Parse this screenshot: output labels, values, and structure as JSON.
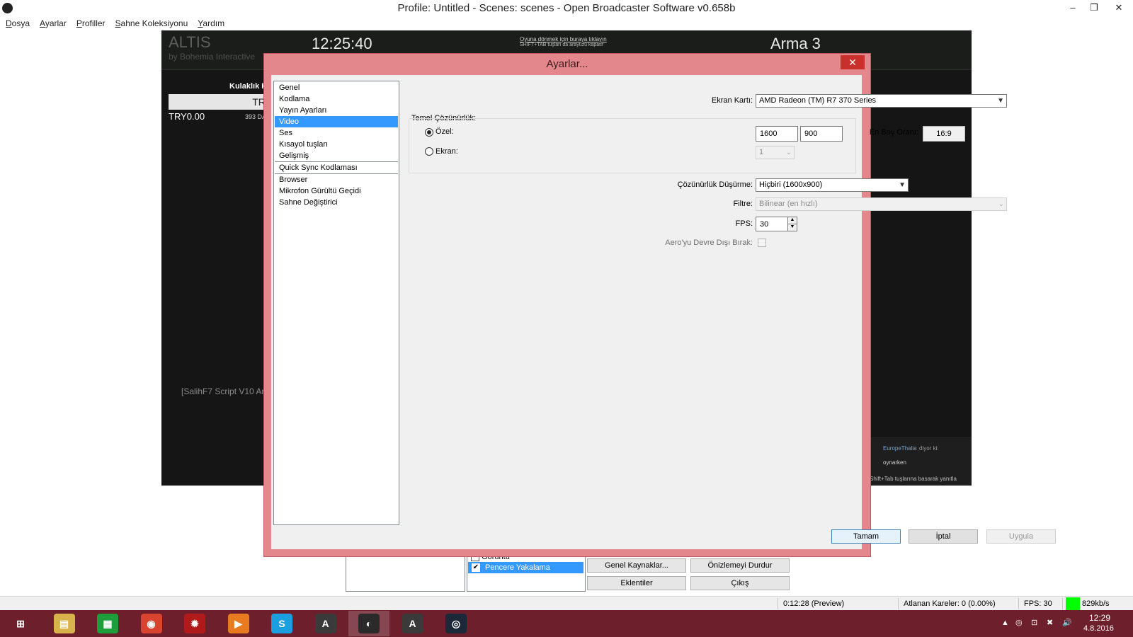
{
  "window": {
    "title": "Profile: Untitled - Scenes: scenes - Open Broadcaster Software v0.658b",
    "minimize": "–",
    "maximize": "❐",
    "close": "✕"
  },
  "menubar": [
    "Dosya",
    "Ayarlar",
    "Profiller",
    "Sahne Koleksiyonu",
    "Yardım"
  ],
  "preview": {
    "map_title": "ALTIS",
    "map_subtitle": "by Bohemia Interactive",
    "clock": "12:25:40",
    "overlay_line1": "Oyuna dönmek için buraya tıklayın",
    "overlay_line2": "SHIFT+TAB tuşları da arayüzü kapatır",
    "game_name": "Arma 3",
    "headset_label": "Kulaklık K",
    "price_box": "TRY",
    "balance": "TRY0.00",
    "balance_sub": "393 DA",
    "script_text": "[SalihF7 Script V10 Ar",
    "chat_user": "EuropeThalia",
    "chat_says": "diyor ki:",
    "chat_message": "oynarken",
    "chat_hint": "Shift+Tab tuşlarına basarak yanıtla"
  },
  "dialog": {
    "title": "Ayarlar...",
    "close": "✕",
    "nav_items": [
      "Genel",
      "Kodlama",
      "Yayın Ayarları",
      "Video",
      "Ses",
      "Kısayol tuşları",
      "Gelişmiş",
      "Quick Sync Kodlaması",
      "Browser",
      "Mikrofon Gürültü Geçidi",
      "Sahne Değiştirici"
    ],
    "selected_nav": "Video",
    "video": {
      "gpu_label": "Ekran Kartı:",
      "gpu_value": "AMD Radeon (TM) R7 370 Series",
      "base_res_label": "Temel Çözünürlük:",
      "custom_label": "Özel:",
      "custom_width": "1600",
      "custom_height": "900",
      "aspect_label": "En Boy Oranı:",
      "aspect_value": "16:9",
      "monitor_label": "Ekran:",
      "monitor_value": "1",
      "downscale_label": "Çözünürlük Düşürme:",
      "downscale_value": "Hiçbiri  (1600x900)",
      "filter_label": "Filtre:",
      "filter_value": "Bilinear (en hızlı)",
      "fps_label": "FPS:",
      "fps_value": "30",
      "aero_label": "Aero'yu Devre Dışı Bırak:"
    },
    "buttons": {
      "ok": "Tamam",
      "cancel": "İptal",
      "apply": "Uygula"
    }
  },
  "main": {
    "sources": [
      {
        "label": "Görüntü",
        "checked": false
      },
      {
        "label": "Pencere Yakalama",
        "checked": true
      }
    ],
    "buttons": {
      "global_sources": "Genel Kaynaklar...",
      "stop_preview": "Önizlemeyi Durdur",
      "plugins": "Eklentiler",
      "exit": "Çıkış"
    }
  },
  "status": {
    "time": "0:12:28 (Preview)",
    "dropped": "Atlanan Kareler: 0 (0.00%)",
    "fps": "FPS: 30",
    "bitrate": "829kb/s",
    "bitrate_color": "#00ff00"
  },
  "taskbar": {
    "apps": [
      {
        "name": "windows-start-icon",
        "glyph": "⊞",
        "color": "#6d1f2c"
      },
      {
        "name": "file-explorer-icon",
        "glyph": "▤",
        "color": "#d8b24a"
      },
      {
        "name": "store-icon",
        "glyph": "▦",
        "color": "#1e9e3a"
      },
      {
        "name": "chrome-icon",
        "glyph": "◉",
        "color": "#d8442f"
      },
      {
        "name": "game-launcher-icon",
        "glyph": "✹",
        "color": "#b11a1a"
      },
      {
        "name": "media-player-icon",
        "glyph": "▶",
        "color": "#e87a1f"
      },
      {
        "name": "skype-icon",
        "glyph": "S",
        "color": "#1aa0e0"
      },
      {
        "name": "arma-launcher-icon",
        "glyph": "A",
        "color": "#3a3a3a"
      },
      {
        "name": "obs-icon",
        "glyph": "◐",
        "color": "#2a2a2a"
      },
      {
        "name": "arma3-icon",
        "glyph": "A",
        "color": "#3a3a3a"
      },
      {
        "name": "steam-icon",
        "glyph": "◎",
        "color": "#1b2838"
      }
    ],
    "active_index": 8,
    "time": "12:29",
    "date": "4.8.2016",
    "tray_icons": [
      "▲",
      "◎",
      "⊡",
      "✖",
      "🔊"
    ]
  }
}
